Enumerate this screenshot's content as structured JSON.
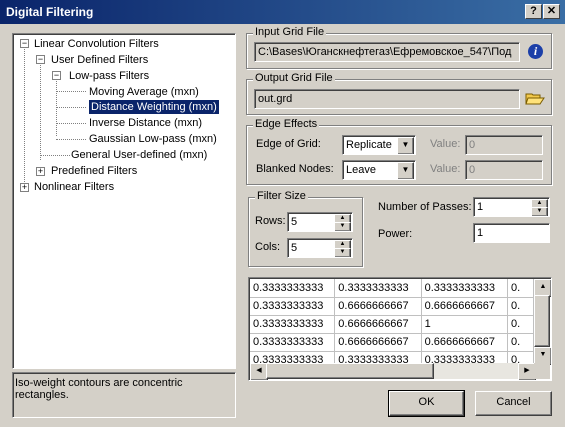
{
  "window": {
    "title": "Digital Filtering"
  },
  "titlebar_buttons": {
    "help": "?",
    "close": "✕"
  },
  "tree": {
    "linear": "Linear Convolution Filters",
    "user_defined": "User Defined Filters",
    "low_pass": "Low-pass Filters",
    "moving_average": "Moving Average (mxn)",
    "distance_weighting": "Distance Weighting (mxn)",
    "inverse_distance": "Inverse Distance (mxn)",
    "gaussian": "Gaussian Low-pass (mxn)",
    "general_user": "General User-defined (mxn)",
    "predefined": "Predefined Filters",
    "nonlinear": "Nonlinear Filters"
  },
  "description": "Iso-weight contours are concentric rectangles.",
  "input_grid": {
    "label": "Input Grid File",
    "value": "C:\\Bases\\Юганскнефтегаз\\Ефремовское_547\\Под"
  },
  "output_grid": {
    "label": "Output Grid File",
    "value": "out.grd"
  },
  "edge_effects": {
    "label": "Edge Effects",
    "edge_of_grid_label": "Edge of Grid:",
    "edge_of_grid_value": "Replicate",
    "edge_value_label": "Value:",
    "edge_value": "0",
    "blanked_label": "Blanked Nodes:",
    "blanked_value": "Leave",
    "blanked_value_label": "Value:",
    "blanked_field": "0"
  },
  "filter_size": {
    "label": "Filter Size",
    "rows_label": "Rows:",
    "rows": "5",
    "cols_label": "Cols:",
    "cols": "5"
  },
  "passes": {
    "label": "Number of Passes:",
    "value": "1"
  },
  "power": {
    "label": "Power:",
    "value": "1"
  },
  "matrix": {
    "rows": [
      [
        "0.3333333333",
        "0.3333333333",
        "0.3333333333",
        "0."
      ],
      [
        "0.3333333333",
        "0.6666666667",
        "0.6666666667",
        "0."
      ],
      [
        "0.3333333333",
        "0.6666666667",
        "1",
        "0."
      ],
      [
        "0.3333333333",
        "0.6666666667",
        "0.6666666667",
        "0."
      ],
      [
        "0.3333333333",
        "0.3333333333",
        "0.3333333333",
        "0."
      ]
    ]
  },
  "buttons": {
    "ok": "OK",
    "cancel": "Cancel"
  },
  "icons": {
    "info": "info-icon",
    "open_folder": "open-folder-icon"
  }
}
